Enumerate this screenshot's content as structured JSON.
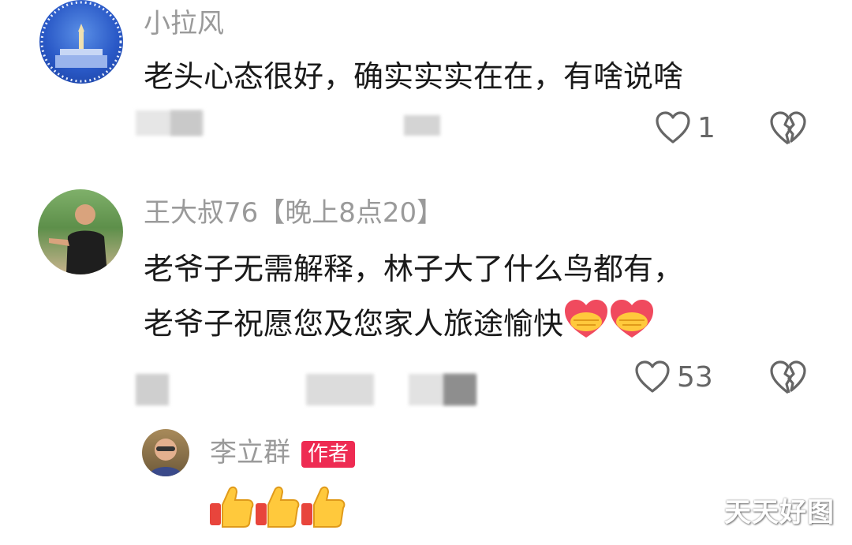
{
  "comments": [
    {
      "username": "小拉风",
      "text_lines": [
        "老头心态很好，确实实实在在，有啥说啥"
      ],
      "likes": "1"
    },
    {
      "username": "王大叔76【晚上8点20】",
      "text_lines": [
        "老爷子无需解释，林子大了什么鸟都有，",
        "老爷子祝愿您及您家人旅途愉快"
      ],
      "likes": "53"
    }
  ],
  "reply": {
    "username": "李立群",
    "badge": "作者"
  },
  "watermark": "天天好图",
  "colors": {
    "badge": "#ee2b52",
    "username": "#9a9a9a"
  },
  "icons": [
    "heart-outline-icon",
    "broken-heart-icon",
    "handshake-emoji-icon",
    "thumbs-up-emoji-icon"
  ]
}
